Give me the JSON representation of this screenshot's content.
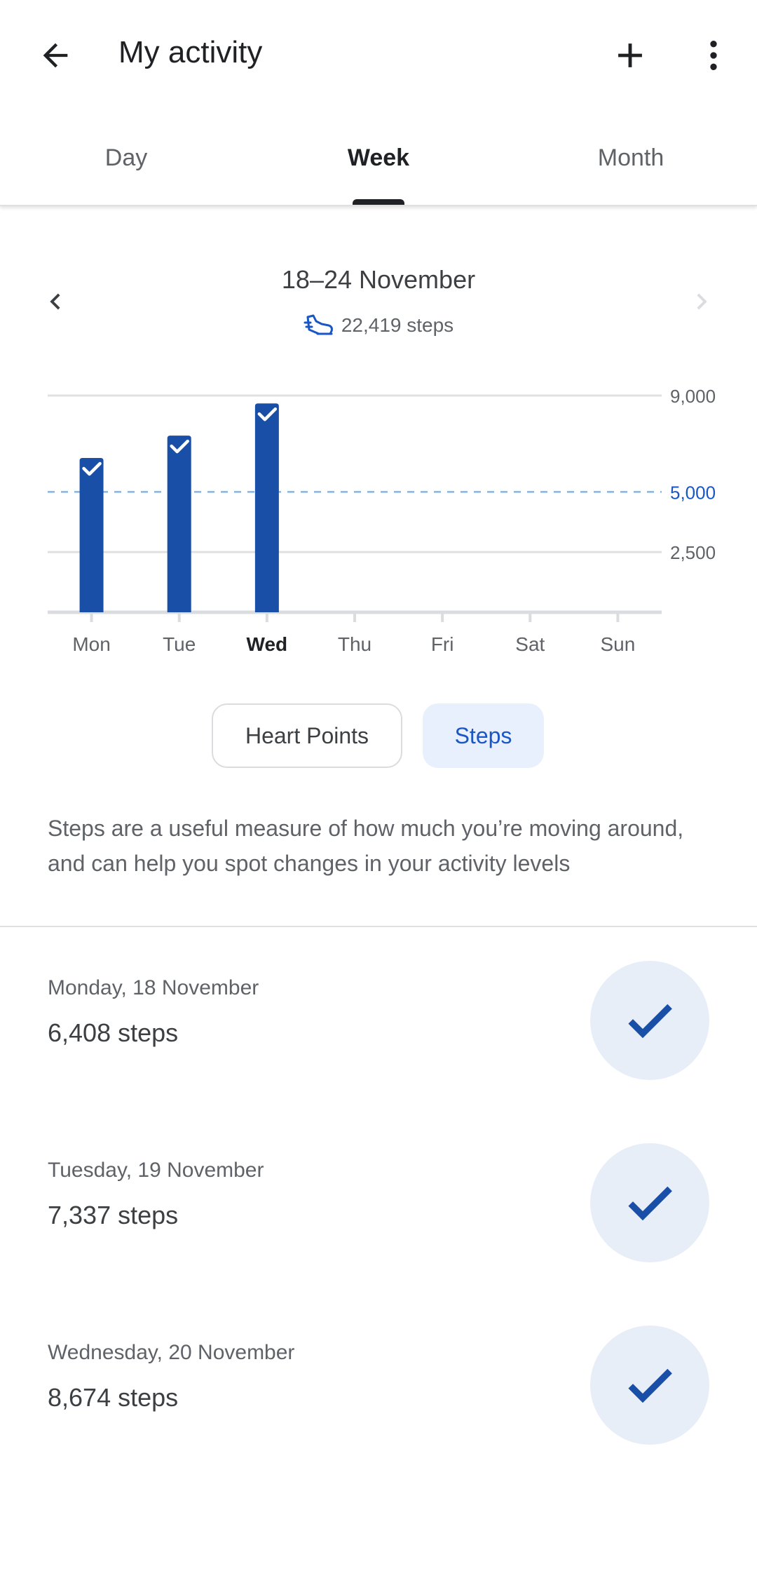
{
  "appbar": {
    "title": "My activity",
    "back_icon": "arrow-left-icon",
    "add_icon": "plus-icon",
    "more_icon": "more-vert-icon"
  },
  "tabs": [
    {
      "label": "Day",
      "active": false
    },
    {
      "label": "Week",
      "active": true
    },
    {
      "label": "Month",
      "active": false
    }
  ],
  "week": {
    "title": "18–24 November",
    "steps_summary": "22,419 steps"
  },
  "chart_data": {
    "type": "bar",
    "categories": [
      "Mon",
      "Tue",
      "Wed",
      "Thu",
      "Fri",
      "Sat",
      "Sun"
    ],
    "highlight_category": "Wed",
    "values": [
      6408,
      7337,
      8674,
      null,
      null,
      null,
      null
    ],
    "goal": 5000,
    "goal_label": "5,000",
    "ylim": [
      0,
      9000
    ],
    "yticks": [
      {
        "value": 9000,
        "label": "9,000"
      },
      {
        "value": 2500,
        "label": "2,500"
      }
    ],
    "bar_color": "#1a4fa8",
    "goal_color": "#1a56c4",
    "grid": true
  },
  "toggle": {
    "heart_points_label": "Heart Points",
    "steps_label": "Steps"
  },
  "description": "Steps are a useful measure of how much you’re moving around, and can help you spot changes in your activity levels",
  "days": [
    {
      "date": "Monday, 18 November",
      "steps": "6,408 steps"
    },
    {
      "date": "Tuesday, 19 November",
      "steps": "7,337 steps"
    },
    {
      "date": "Wednesday, 20 November",
      "steps": "8,674 steps"
    }
  ],
  "colors": {
    "accent": "#1a56c4",
    "bar": "#1a4fa8",
    "badge_bg": "#e8eef7",
    "chip_active_bg": "#e8f0fe"
  }
}
